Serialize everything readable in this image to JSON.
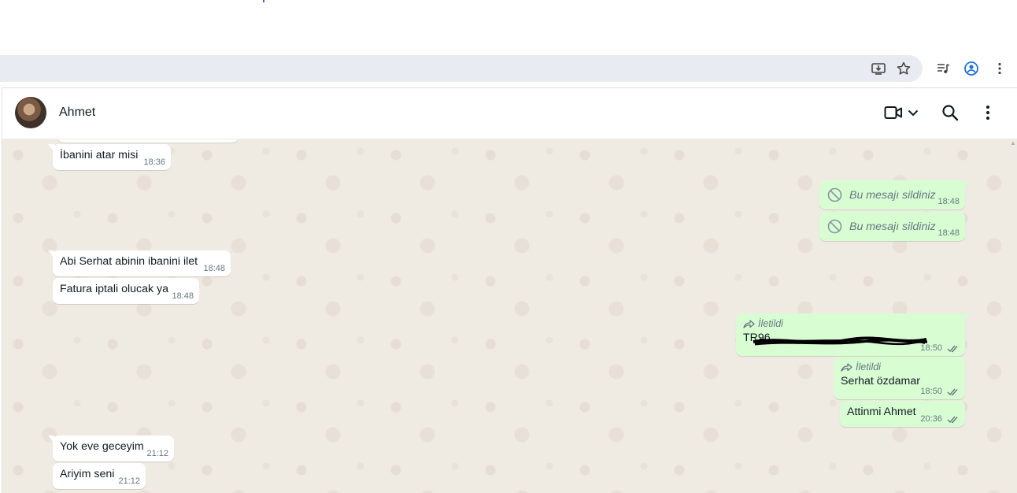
{
  "chat": {
    "contact_name": "Ahmet",
    "messages": [
      {
        "dir": "in",
        "text": "İbanini atar misi",
        "time": "18:36"
      },
      {
        "dir": "out",
        "text": "Bu mesajı sildiniz",
        "time": "18:48",
        "deleted": true
      },
      {
        "dir": "out",
        "text": "Bu mesajı sildiniz",
        "time": "18:48",
        "deleted": true
      },
      {
        "dir": "in",
        "text": "Abi Serhat abinin ibanini ilet",
        "time": "18:48"
      },
      {
        "dir": "in",
        "text": "Fatura iptali olucak ya",
        "time": "18:48"
      },
      {
        "dir": "out",
        "forwarded_label": "İletildi",
        "text": "TR96",
        "time": "18:50",
        "redacted": true
      },
      {
        "dir": "out",
        "forwarded_label": "İletildi",
        "text": "Serhat özdamar",
        "time": "18:50"
      },
      {
        "dir": "out",
        "text": "Attinmi Ahmet",
        "time": "20:36"
      },
      {
        "dir": "in",
        "text": "Yok eve geceyim",
        "time": "21:12"
      },
      {
        "dir": "in",
        "text": "Ariyim seni",
        "time": "21:12"
      }
    ]
  },
  "icons": {
    "browser": [
      "install-app-icon",
      "star-icon",
      "media-queue-icon",
      "profile-icon",
      "more-vert-icon"
    ],
    "header": [
      "video-call-icon",
      "chevron-down-icon",
      "search-icon",
      "more-vert-icon"
    ],
    "message": [
      "blocked-icon",
      "forward-icon",
      "double-check-icon"
    ]
  },
  "colors": {
    "incoming_bubble": "#ffffff",
    "outgoing_bubble": "#d9fdd3",
    "chat_background": "#efeae2",
    "omnibox": "#e8ebf1",
    "profile_accent": "#1a73e8"
  }
}
